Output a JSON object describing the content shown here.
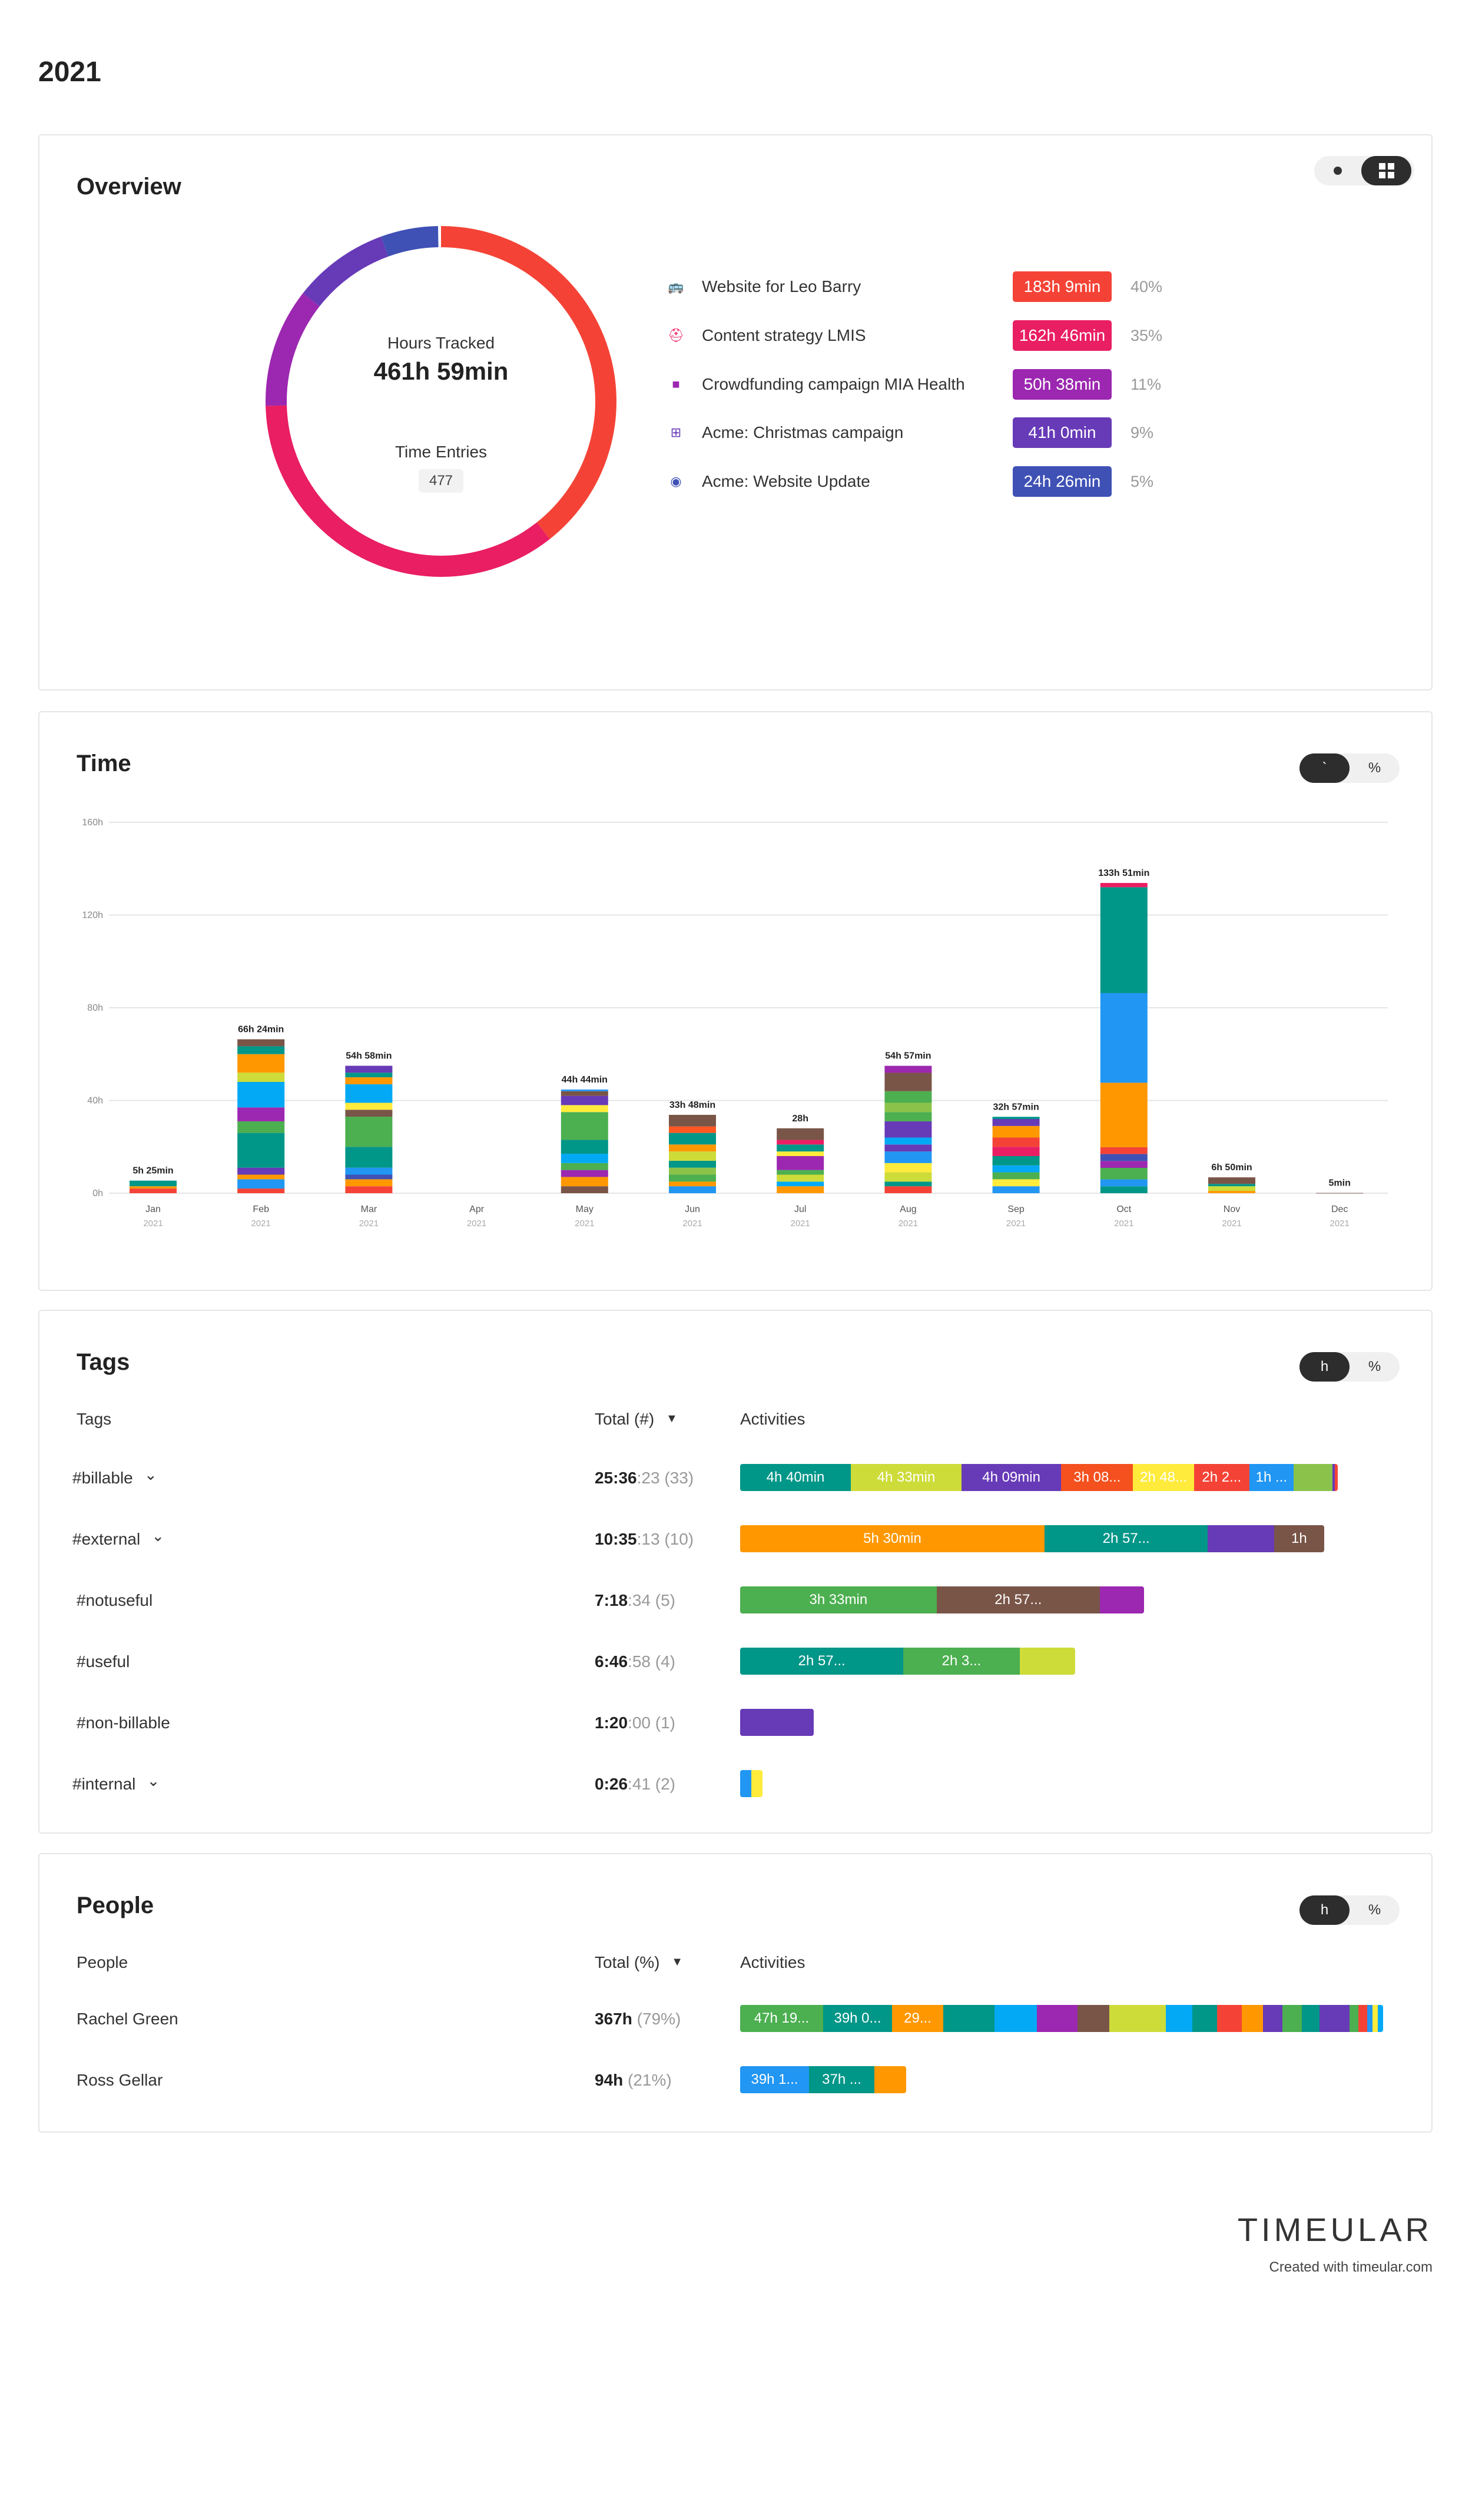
{
  "page": {
    "title": "2021"
  },
  "overview": {
    "title": "Overview",
    "center": {
      "hours_label": "Hours Tracked",
      "hours_value": "461h 59min",
      "entries_label": "Time Entries",
      "entries_value": "477"
    },
    "ring": [
      {
        "name": "Website for Leo Barry",
        "fraction": 0.3935,
        "color": "#f44336"
      },
      {
        "name": "Content strategy LMIS",
        "fraction": 0.3525,
        "color": "#e91e63"
      },
      {
        "name": "Crowdfunding campaign MIA Health",
        "fraction": 0.1098,
        "color": "#9c27b0"
      },
      {
        "name": "Acme: Christmas campaign",
        "fraction": 0.0887,
        "color": "#673ab7"
      },
      {
        "name": "Acme: Website Update",
        "fraction": 0.0528,
        "color": "#3f51b5"
      }
    ],
    "legend": [
      {
        "icon": "bus-icon",
        "glyph": "🚌",
        "name": "Website for Leo Barry",
        "time": "183h 9min",
        "pct": "40%",
        "color": "#f44336"
      },
      {
        "icon": "hat-icon",
        "glyph": "⛑",
        "name": "Content strategy LMIS",
        "time": "162h 46min",
        "pct": "35%",
        "color": "#e91e63"
      },
      {
        "icon": "video-camera-icon",
        "glyph": "■",
        "name": "Crowdfunding campaign MIA Health",
        "time": "50h 38min",
        "pct": "11%",
        "color": "#9c27b0"
      },
      {
        "icon": "add-to-queue-icon",
        "glyph": "⊞",
        "name": "Acme: Christmas campaign",
        "time": "41h 0min",
        "pct": "9%",
        "color": "#673ab7"
      },
      {
        "icon": "globe-icon",
        "glyph": "◉",
        "name": "Acme: Website Update",
        "time": "24h 26min",
        "pct": "5%",
        "color": "#3f51b5"
      }
    ]
  },
  "time": {
    "title": "Time",
    "toggle": {
      "left": "`",
      "right": "%"
    }
  },
  "chart_data": {
    "type": "bar",
    "stacked": true,
    "categories": [
      "Jan",
      "Feb",
      "Mar",
      "Apr",
      "May",
      "Jun",
      "Jul",
      "Aug",
      "Sep",
      "Oct",
      "Nov",
      "Dec"
    ],
    "category_sublabel": "2021",
    "ylim": [
      0,
      160
    ],
    "yticks": [
      0,
      40,
      80,
      120,
      160
    ],
    "ytick_labels": [
      "0h",
      "40h",
      "80h",
      "120h",
      "160h"
    ],
    "grid": true,
    "totals_hours": [
      5.42,
      66.4,
      54.97,
      0,
      44.73,
      33.8,
      28,
      54.95,
      32.95,
      133.85,
      6.83,
      0.08
    ],
    "total_labels": [
      "5h 25min",
      "66h 24min",
      "54h 58min",
      "",
      "44h 44min",
      "33h 48min",
      "28h",
      "54h 57min",
      "32h 57min",
      "133h 51min",
      "6h 50min",
      "5min"
    ],
    "segments": [
      [
        [
          2,
          "#f44336"
        ],
        [
          1,
          "#ff9800"
        ],
        [
          2.42,
          "#009688"
        ]
      ],
      [
        [
          2,
          "#f44336"
        ],
        [
          4,
          "#2196f3"
        ],
        [
          2,
          "#ff9800"
        ],
        [
          3,
          "#673ab7"
        ],
        [
          15,
          "#009688"
        ],
        [
          5,
          "#4caf50"
        ],
        [
          6,
          "#9c27b0"
        ],
        [
          11,
          "#03a9f4"
        ],
        [
          4,
          "#cddc39"
        ],
        [
          8,
          "#ff9800"
        ],
        [
          3.4,
          "#009688"
        ],
        [
          3,
          "#795548"
        ]
      ],
      [
        [
          3,
          "#f44336"
        ],
        [
          3,
          "#ff9800"
        ],
        [
          2,
          "#3f51b5"
        ],
        [
          3,
          "#2196f3"
        ],
        [
          9,
          "#009688"
        ],
        [
          13,
          "#4caf50"
        ],
        [
          3,
          "#795548"
        ],
        [
          3,
          "#ffeb3b"
        ],
        [
          8,
          "#03a9f4"
        ],
        [
          3,
          "#ff9800"
        ],
        [
          2,
          "#009688"
        ],
        [
          2.97,
          "#673ab7"
        ]
      ],
      [],
      [
        [
          3,
          "#795548"
        ],
        [
          4,
          "#ff9800"
        ],
        [
          3,
          "#9c27b0"
        ],
        [
          3,
          "#4caf50"
        ],
        [
          4,
          "#03a9f4"
        ],
        [
          6,
          "#009688"
        ],
        [
          12,
          "#4caf50"
        ],
        [
          3,
          "#ffeb3b"
        ],
        [
          4,
          "#673ab7"
        ],
        [
          2,
          "#795548"
        ],
        [
          0.73,
          "#2196f3"
        ]
      ],
      [
        [
          3,
          "#2196f3"
        ],
        [
          2,
          "#ff9800"
        ],
        [
          3,
          "#4caf50"
        ],
        [
          3,
          "#8bc34a"
        ],
        [
          3,
          "#009688"
        ],
        [
          4,
          "#cddc39"
        ],
        [
          3,
          "#ff9800"
        ],
        [
          5,
          "#009688"
        ],
        [
          2.8,
          "#ff5722"
        ],
        [
          5,
          "#795548"
        ]
      ],
      [
        [
          3,
          "#ff9800"
        ],
        [
          2,
          "#03a9f4"
        ],
        [
          3,
          "#cddc39"
        ],
        [
          2,
          "#4caf50"
        ],
        [
          6,
          "#9c27b0"
        ],
        [
          2,
          "#ffeb3b"
        ],
        [
          3,
          "#009688"
        ],
        [
          2,
          "#e91e63"
        ],
        [
          5,
          "#795548"
        ]
      ],
      [
        [
          3,
          "#f44336"
        ],
        [
          2,
          "#009688"
        ],
        [
          4,
          "#cddc39"
        ],
        [
          4,
          "#ffeb3b"
        ],
        [
          5,
          "#2196f3"
        ],
        [
          3,
          "#673ab7"
        ],
        [
          3,
          "#03a9f4"
        ],
        [
          7,
          "#673ab7"
        ],
        [
          4,
          "#4caf50"
        ],
        [
          4,
          "#8bc34a"
        ],
        [
          5,
          "#4caf50"
        ],
        [
          7.95,
          "#795548"
        ],
        [
          3,
          "#9c27b0"
        ]
      ],
      [
        [
          3,
          "#2196f3"
        ],
        [
          3,
          "#ffeb3b"
        ],
        [
          3,
          "#4caf50"
        ],
        [
          3,
          "#03a9f4"
        ],
        [
          4,
          "#009688"
        ],
        [
          4,
          "#e91e63"
        ],
        [
          4,
          "#f44336"
        ],
        [
          5,
          "#ff9800"
        ],
        [
          3,
          "#673ab7"
        ],
        [
          0.95,
          "#009688"
        ]
      ],
      [
        [
          3,
          "#009688"
        ],
        [
          3,
          "#2196f3"
        ],
        [
          5,
          "#4caf50"
        ],
        [
          3,
          "#9c27b0"
        ],
        [
          3,
          "#3f51b5"
        ],
        [
          3,
          "#f44336"
        ],
        [
          28,
          "#ff9800"
        ],
        [
          39,
          "#2196f3"
        ],
        [
          46,
          "#009688"
        ],
        [
          1.85,
          "#e91e63"
        ]
      ],
      [
        [
          1,
          "#ff9800"
        ],
        [
          2,
          "#cddc39"
        ],
        [
          1,
          "#009688"
        ],
        [
          2.83,
          "#795548"
        ]
      ],
      [
        [
          0.08,
          "#795548"
        ]
      ]
    ]
  },
  "tags": {
    "title": "Tags",
    "toggle": {
      "left": "h",
      "right": "%"
    },
    "col_name": "Tags",
    "col_total": "Total (#)",
    "col_activities": "Activities",
    "rows": [
      {
        "name": "#billable",
        "expandable": true,
        "total_bold": "25:36",
        "total_dim": ":23 (33)",
        "segments": [
          [
            "4h 40min",
            "#009688",
            2
          ],
          [
            "4h 33min",
            "#cddc39",
            2
          ],
          [
            "4h 09min",
            "#673ab7",
            1.8
          ],
          [
            "3h 08...",
            "#f4511e",
            1.3
          ],
          [
            "2h 48...",
            "#ffeb3b",
            1.1
          ],
          [
            "2h 2...",
            "#f44336",
            1
          ],
          [
            "1h ...",
            "#2196f3",
            0.8
          ],
          [
            "",
            "#8bc34a",
            0.7
          ],
          [
            "",
            "#673ab7",
            0.05
          ],
          [
            "",
            "#f44336",
            0.05
          ]
        ]
      },
      {
        "name": "#external",
        "expandable": true,
        "total_bold": "10:35",
        "total_dim": ":13 (10)",
        "segments": [
          [
            "5h 30min",
            "#ff9800",
            5.5
          ],
          [
            "2h 57...",
            "#009688",
            2.95
          ],
          [
            "",
            "#673ab7",
            1.2
          ],
          [
            "1h",
            "#795548",
            0.9
          ]
        ]
      },
      {
        "name": "#notuseful",
        "expandable": false,
        "total_bold": "7:18",
        "total_dim": ":34 (5)",
        "segments": [
          [
            "3h 33min",
            "#4caf50",
            3.55
          ],
          [
            "2h 57...",
            "#795548",
            2.95
          ],
          [
            "",
            "#9c27b0",
            0.8
          ]
        ]
      },
      {
        "name": "#useful",
        "expandable": false,
        "total_bold": "6:46",
        "total_dim": ":58 (4)",
        "segments": [
          [
            "2h 57...",
            "#009688",
            2.95
          ],
          [
            "2h 3...",
            "#4caf50",
            2.1
          ],
          [
            "",
            "#cddc39",
            1.0
          ]
        ]
      },
      {
        "name": "#non-billable",
        "expandable": false,
        "total_bold": "1:20",
        "total_dim": ":00 (1)",
        "segments": [
          [
            "",
            "#673ab7",
            1.33
          ]
        ]
      },
      {
        "name": "#internal",
        "expandable": true,
        "total_bold": "0:26",
        "total_dim": ":41 (2)",
        "segments": [
          [
            "",
            "#2196f3",
            0.2
          ],
          [
            "",
            "#ffeb3b",
            0.2
          ]
        ]
      }
    ]
  },
  "people": {
    "title": "People",
    "toggle": {
      "left": "h",
      "right": "%"
    },
    "col_name": "People",
    "col_total": "Total (%)",
    "col_activities": "Activities",
    "rows": [
      {
        "name": "Rachel Green",
        "total_bold": "367h",
        "total_dim": " (79%)",
        "segments": [
          [
            "47h 19...",
            "#4caf50",
            47
          ],
          [
            "39h 0...",
            "#009688",
            39
          ],
          [
            "29...",
            "#ff9800",
            29
          ],
          [
            "",
            "#009688",
            29
          ],
          [
            "",
            "#03a9f4",
            24
          ],
          [
            "",
            "#9c27b0",
            23
          ],
          [
            "",
            "#795548",
            18
          ],
          [
            "",
            "#cddc39",
            32
          ],
          [
            "",
            "#03a9f4",
            15
          ],
          [
            "",
            "#009688",
            14
          ],
          [
            "",
            "#f44336",
            14
          ],
          [
            "",
            "#ff9800",
            12
          ],
          [
            "",
            "#673ab7",
            11
          ],
          [
            "",
            "#4caf50",
            11
          ],
          [
            "",
            "#009688",
            10
          ],
          [
            "",
            "#673ab7",
            17
          ],
          [
            "",
            "#4caf50",
            5
          ],
          [
            "",
            "#f44336",
            5
          ],
          [
            "",
            "#2196f3",
            3
          ],
          [
            "",
            "#ffeb3b",
            3
          ],
          [
            "",
            "#03a9f4",
            3
          ]
        ]
      },
      {
        "name": "Ross Gellar",
        "total_bold": "94h",
        "total_dim": " (21%)",
        "segments": [
          [
            "39h 1...",
            "#2196f3",
            39
          ],
          [
            "37h ...",
            "#009688",
            37
          ],
          [
            "",
            "#ff9800",
            18
          ]
        ]
      }
    ]
  },
  "footer": {
    "brand": "TIMEULAR",
    "created_with": "Created with timeular.com"
  }
}
